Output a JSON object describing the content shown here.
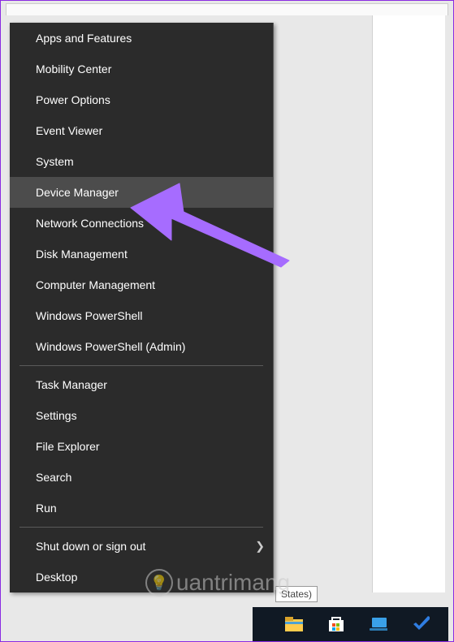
{
  "menu": {
    "groups": [
      [
        {
          "label": "Apps and Features",
          "key": "apps-and-features"
        },
        {
          "label": "Mobility Center",
          "key": "mobility-center"
        },
        {
          "label": "Power Options",
          "key": "power-options"
        },
        {
          "label": "Event Viewer",
          "key": "event-viewer"
        },
        {
          "label": "System",
          "key": "system"
        },
        {
          "label": "Device Manager",
          "key": "device-manager",
          "highlighted": true
        },
        {
          "label": "Network Connections",
          "key": "network-connections"
        },
        {
          "label": "Disk Management",
          "key": "disk-management"
        },
        {
          "label": "Computer Management",
          "key": "computer-management"
        },
        {
          "label": "Windows PowerShell",
          "key": "windows-powershell"
        },
        {
          "label": "Windows PowerShell (Admin)",
          "key": "windows-powershell-admin"
        }
      ],
      [
        {
          "label": "Task Manager",
          "key": "task-manager"
        },
        {
          "label": "Settings",
          "key": "settings"
        },
        {
          "label": "File Explorer",
          "key": "file-explorer"
        },
        {
          "label": "Search",
          "key": "search"
        },
        {
          "label": "Run",
          "key": "run"
        }
      ],
      [
        {
          "label": "Shut down or sign out",
          "key": "shutdown-signout",
          "submenu": true
        },
        {
          "label": "Desktop",
          "key": "desktop"
        }
      ]
    ]
  },
  "lang_indicator": "States)",
  "watermark_text": "uantrimang",
  "arrow_color": "#a66cff"
}
